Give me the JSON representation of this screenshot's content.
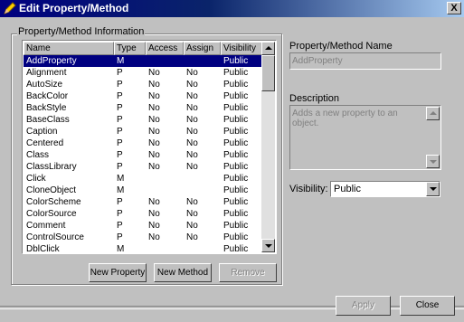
{
  "window": {
    "title": "Edit Property/Method",
    "close_label": "X"
  },
  "group": {
    "label": "Property/Method Information"
  },
  "list": {
    "columns": [
      "Name",
      "Type",
      "Access",
      "Assign",
      "Visibility"
    ],
    "rows": [
      [
        "AddProperty",
        "M",
        "",
        "",
        "Public"
      ],
      [
        "Alignment",
        "P",
        "No",
        "No",
        "Public"
      ],
      [
        "AutoSize",
        "P",
        "No",
        "No",
        "Public"
      ],
      [
        "BackColor",
        "P",
        "No",
        "No",
        "Public"
      ],
      [
        "BackStyle",
        "P",
        "No",
        "No",
        "Public"
      ],
      [
        "BaseClass",
        "P",
        "No",
        "No",
        "Public"
      ],
      [
        "Caption",
        "P",
        "No",
        "No",
        "Public"
      ],
      [
        "Centered",
        "P",
        "No",
        "No",
        "Public"
      ],
      [
        "Class",
        "P",
        "No",
        "No",
        "Public"
      ],
      [
        "ClassLibrary",
        "P",
        "No",
        "No",
        "Public"
      ],
      [
        "Click",
        "M",
        "",
        "",
        "Public"
      ],
      [
        "CloneObject",
        "M",
        "",
        "",
        "Public"
      ],
      [
        "ColorScheme",
        "P",
        "No",
        "No",
        "Public"
      ],
      [
        "ColorSource",
        "P",
        "No",
        "No",
        "Public"
      ],
      [
        "Comment",
        "P",
        "No",
        "No",
        "Public"
      ],
      [
        "ControlSource",
        "P",
        "No",
        "No",
        "Public"
      ],
      [
        "DblClick",
        "M",
        "",
        "",
        "Public"
      ]
    ]
  },
  "buttons": {
    "new_property": "New Property",
    "new_method": "New Method",
    "remove": "Remove",
    "apply": "Apply",
    "close": "Close"
  },
  "name_field": {
    "label": "Property/Method Name",
    "value": "AddProperty"
  },
  "description": {
    "label": "Description",
    "value": "Adds a new property to an object."
  },
  "visibility": {
    "label": "Visibility:",
    "value": "Public"
  }
}
